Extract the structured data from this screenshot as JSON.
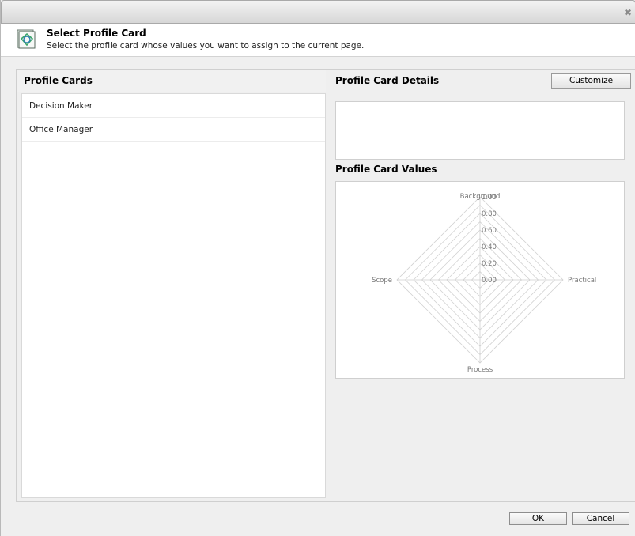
{
  "dialog": {
    "close_glyph": "✖"
  },
  "header": {
    "title": "Select Profile Card",
    "subtitle": "Select the profile card whose values you want to assign to the current page.",
    "icon": "profile-card-icon"
  },
  "left_panel": {
    "title": "Profile Cards",
    "items": [
      {
        "label": "Decision Maker"
      },
      {
        "label": "Office Manager"
      }
    ]
  },
  "right_panel": {
    "details_title": "Profile Card Details",
    "customize_label": "Customize",
    "values_title": "Profile Card Values"
  },
  "chart_data": {
    "type": "radar",
    "axes": [
      "Background",
      "Practical",
      "Process",
      "Scope"
    ],
    "tick_labels": [
      "1.00",
      "0.80",
      "0.60",
      "0.40",
      "0.20",
      "0.00"
    ],
    "ticks": [
      0,
      0.2,
      0.4,
      0.6,
      0.8,
      1.0
    ],
    "range": [
      0,
      1
    ],
    "grid_rings": 10,
    "values": [],
    "grid": true
  },
  "footer": {
    "ok_label": "OK",
    "cancel_label": "Cancel"
  }
}
